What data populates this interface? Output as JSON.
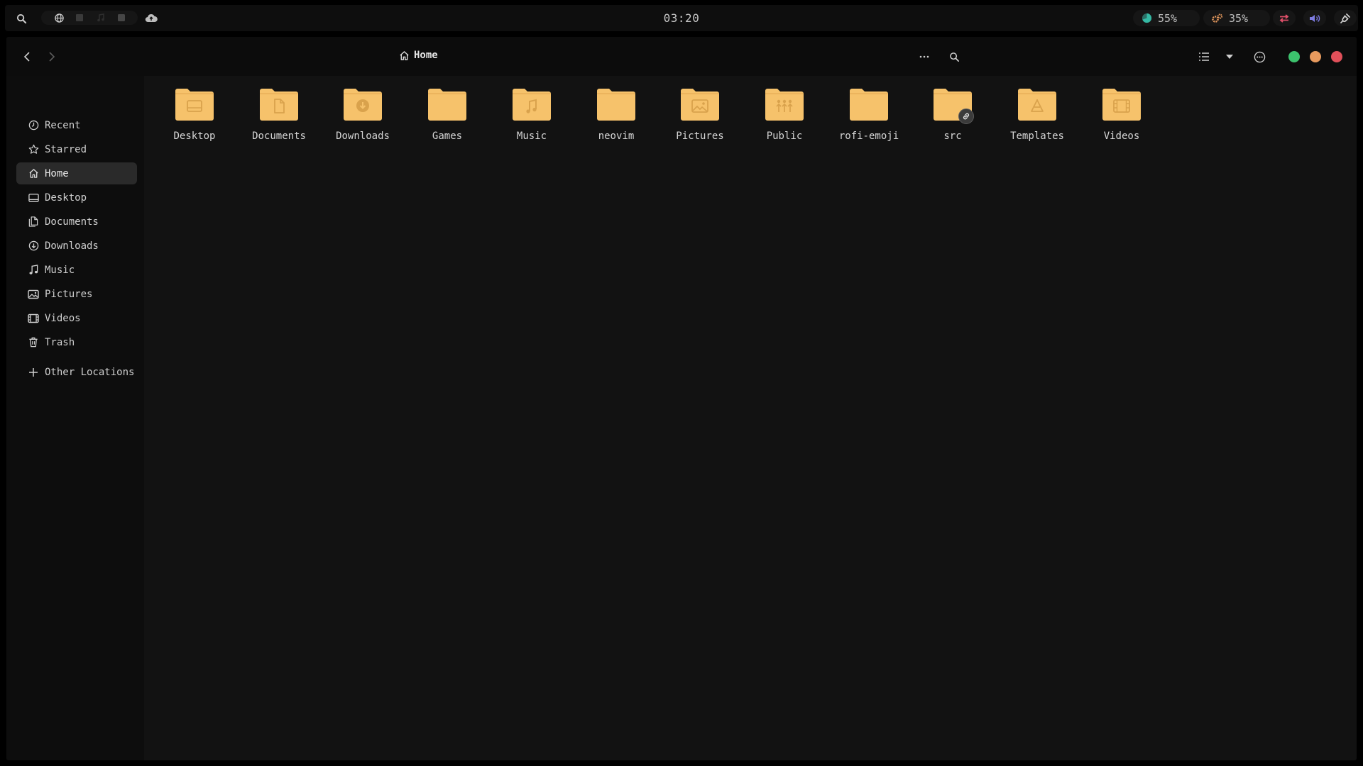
{
  "topbar": {
    "clock": "03:20",
    "cpu_label": "55%",
    "memory_label": "35%",
    "icons": [
      "search-icon",
      "globe-icon",
      "window-icon",
      "music-note-icon",
      "square-icon",
      "cloud-upload-icon",
      "pie-chart-icon",
      "gears-icon",
      "network-icon",
      "volume-icon",
      "plug-icon"
    ],
    "colors": {
      "cpu": "#35b9a4",
      "memory": "#e79a5e",
      "network": "#e0506a",
      "volume": "#7d7be0",
      "plug": "#cfcfcf"
    }
  },
  "window": {
    "location": {
      "label": "Home",
      "icon": "home-icon"
    },
    "controls": {
      "minimize_color": "#3cc26d",
      "maximize_color": "#e79a5e",
      "close_color": "#e0505a"
    }
  },
  "sidebar": {
    "items": [
      {
        "label": "Recent",
        "icon": "clock-icon"
      },
      {
        "label": "Starred",
        "icon": "star-icon"
      },
      {
        "label": "Home",
        "icon": "home-icon",
        "active": true
      },
      {
        "label": "Desktop",
        "icon": "desktop-icon"
      },
      {
        "label": "Documents",
        "icon": "documents-icon"
      },
      {
        "label": "Downloads",
        "icon": "download-icon"
      },
      {
        "label": "Music",
        "icon": "music-icon"
      },
      {
        "label": "Pictures",
        "icon": "picture-icon"
      },
      {
        "label": "Videos",
        "icon": "video-icon"
      },
      {
        "label": "Trash",
        "icon": "trash-icon"
      }
    ],
    "other_locations": "Other Locations"
  },
  "folders": [
    {
      "name": "Desktop",
      "emblem": "desktop"
    },
    {
      "name": "Documents",
      "emblem": "document"
    },
    {
      "name": "Downloads",
      "emblem": "download"
    },
    {
      "name": "Games",
      "emblem": "none"
    },
    {
      "name": "Music",
      "emblem": "music"
    },
    {
      "name": "neovim",
      "emblem": "none"
    },
    {
      "name": "Pictures",
      "emblem": "picture"
    },
    {
      "name": "Public",
      "emblem": "people"
    },
    {
      "name": "rofi-emoji",
      "emblem": "none"
    },
    {
      "name": "src",
      "emblem": "none",
      "symlink": true
    },
    {
      "name": "Templates",
      "emblem": "template"
    },
    {
      "name": "Videos",
      "emblem": "video"
    }
  ],
  "folder_color": "#f6c26b"
}
